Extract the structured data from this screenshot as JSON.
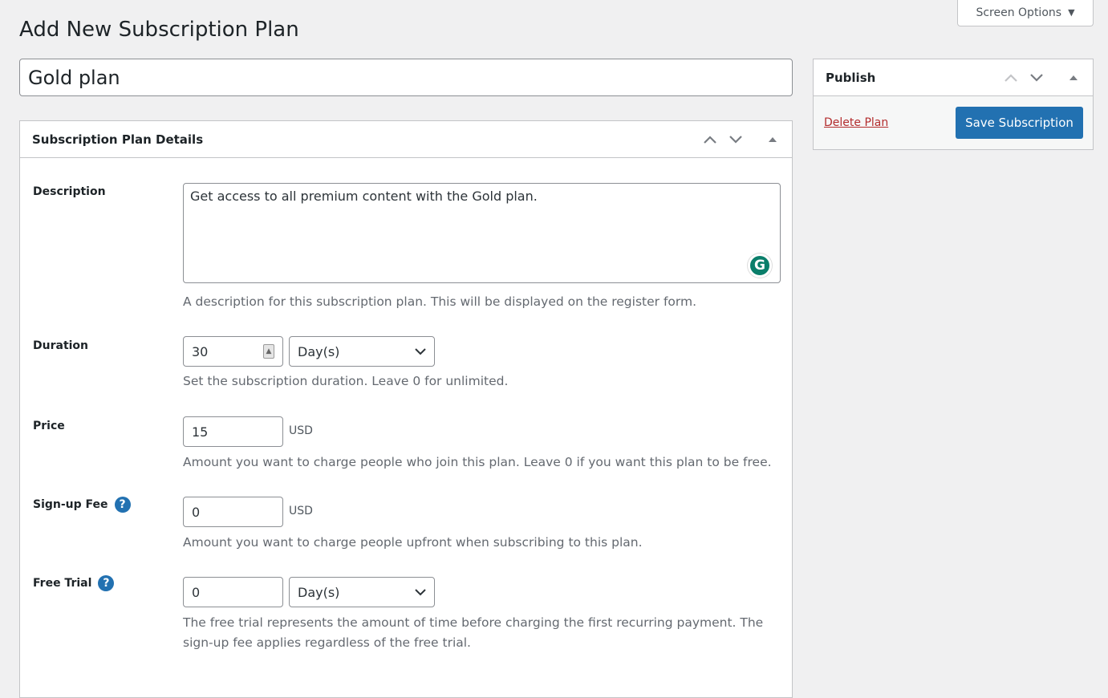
{
  "screen_options": {
    "label": "Screen Options",
    "icon": "caret-down-icon"
  },
  "page_title": "Add New Subscription Plan",
  "plan_name": "Gold plan",
  "details": {
    "title": "Subscription Plan Details",
    "description": {
      "label": "Description",
      "value": "Get access to all premium content with the Gold plan.",
      "help": "A description for this subscription plan. This will be displayed on the register form."
    },
    "duration": {
      "label": "Duration",
      "value": "30",
      "unit": "Day(s)",
      "help": "Set the subscription duration. Leave 0 for unlimited."
    },
    "price": {
      "label": "Price",
      "value": "15",
      "currency": "USD",
      "help": "Amount you want to charge people who join this plan. Leave 0 if you want this plan to be free."
    },
    "signup_fee": {
      "label": "Sign-up Fee",
      "value": "0",
      "currency": "USD",
      "help": "Amount you want to charge people upfront when subscribing to this plan."
    },
    "free_trial": {
      "label": "Free Trial",
      "value": "0",
      "unit": "Day(s)",
      "help": "The free trial represents the amount of time before charging the first recurring payment. The sign-up fee applies regardless of the free trial."
    }
  },
  "publish": {
    "title": "Publish",
    "delete_label": "Delete Plan",
    "save_label": "Save Subscription"
  },
  "colors": {
    "primary": "#2271b1",
    "delete": "#b32d2e",
    "background": "#f0f0f1"
  }
}
